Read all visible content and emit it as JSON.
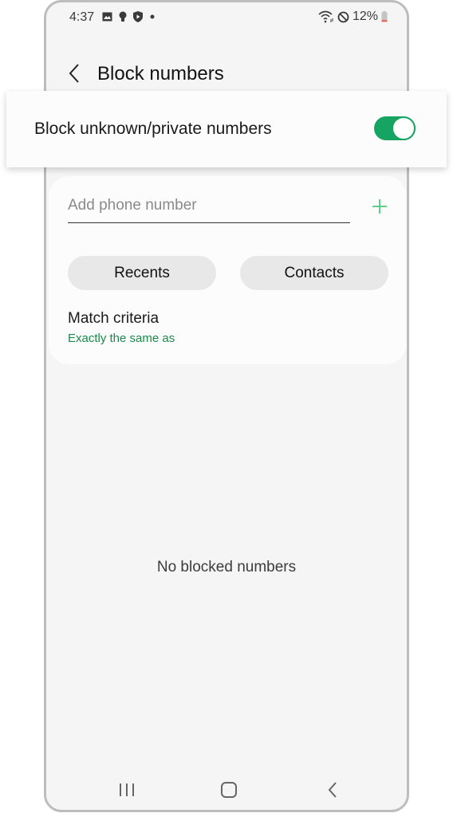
{
  "status_bar": {
    "time": "4:37",
    "left_icons": [
      "gallery-icon",
      "bulb-icon",
      "shield-icon",
      "dot-icon"
    ],
    "right_icons": [
      "wifi-icon",
      "do-not-disturb-icon"
    ],
    "battery": "12%",
    "battery_color": "#e57060"
  },
  "app_bar": {
    "title": "Block numbers"
  },
  "block_unknown": {
    "label": "Block unknown/private numbers",
    "enabled": true,
    "accent": "#16a463"
  },
  "add_number": {
    "placeholder": "Add phone number",
    "value": ""
  },
  "buttons": {
    "recents": "Recents",
    "contacts": "Contacts"
  },
  "match_criteria": {
    "title": "Match criteria",
    "value": "Exactly the same as",
    "value_color": "#1b8a4a"
  },
  "empty_state": "No blocked numbers",
  "nav_bar": {
    "items": [
      "recent-apps",
      "home",
      "back"
    ]
  }
}
